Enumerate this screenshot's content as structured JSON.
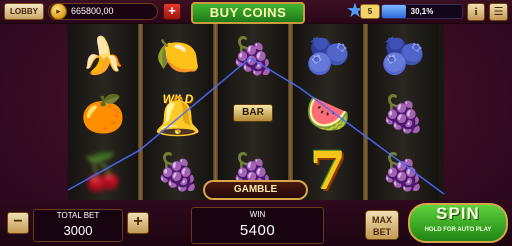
{
  "topbar": {
    "lobby_label": "LOBBY",
    "coin_balance": "665800,00",
    "add_coins_label": "+",
    "buy_coins_label": "BUY COINS",
    "level": "5",
    "xp_percent_label": "30,1%",
    "xp_progress": 0.301,
    "info_label": "i",
    "menu_label": "☰"
  },
  "reels": [
    {
      "symbols": [
        "banana",
        "orange",
        "cherry"
      ]
    },
    {
      "symbols": [
        "lemon",
        "wild-bell",
        "grapes"
      ]
    },
    {
      "symbols": [
        "grapes",
        "bar",
        "grapes"
      ]
    },
    {
      "symbols": [
        "plum",
        "watermelon",
        "seven"
      ]
    },
    {
      "symbols": [
        "plum",
        "grapes",
        "grapes"
      ]
    }
  ],
  "symbol_text": {
    "wild": "WILD",
    "bar": "BAR",
    "seven": "7"
  },
  "controls": {
    "gamble_label": "GAMBLE",
    "total_bet_label": "TOTAL BET",
    "total_bet_value": "3000",
    "minus_label": "−",
    "plus_label": "+",
    "win_label": "WIN",
    "win_value": "5400",
    "max_bet_label_1": "MAX",
    "max_bet_label_2": "BET",
    "spin_label": "SPIN",
    "spin_sub_label": "HOLD FOR AUTO PLAY"
  },
  "colors": {
    "background": "#3a0c22",
    "accent_gold": "#d7a64a",
    "spin_green": "#3fae2a",
    "xp_blue": "#2e6ad8",
    "payline_blue": "#4a6cff"
  }
}
